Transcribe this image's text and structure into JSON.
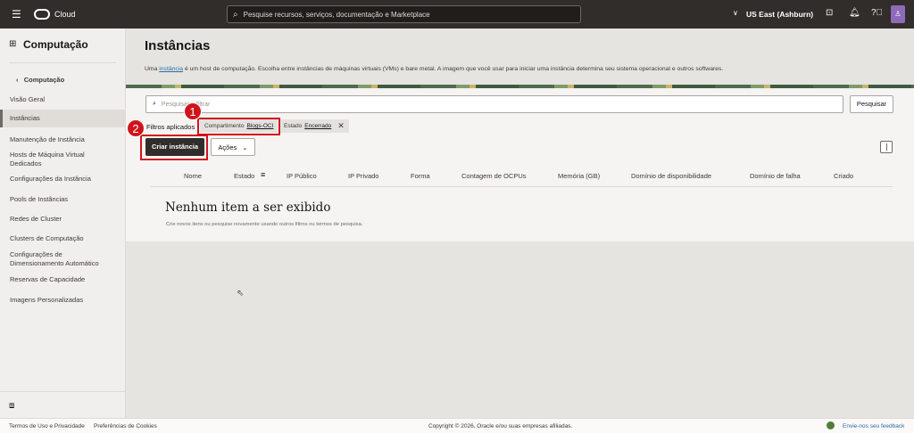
{
  "header": {
    "brand": "Cloud",
    "search_placeholder": "Pesquise recursos, serviços, documentação e Marketplace",
    "region": "US East (Ashburn)"
  },
  "sidebar": {
    "title": "Computação",
    "back": "Computação",
    "items": [
      "Visão Geral",
      "Instâncias",
      "Manutenção de Instância",
      "Hosts de Máquina Virtual Dedicados",
      "Configurações da Instância",
      "Pools de Instâncias",
      "Redes de Cluster",
      "Clusters de Computação",
      "Configurações de Dimensionamento Automático",
      "Reservas de Capacidade",
      "Imagens Personalizadas"
    ]
  },
  "page": {
    "title": "Instâncias",
    "desc_pre": "Uma ",
    "desc_link": "instância",
    "desc_post": " é um host de computação. Escolha entre instâncias de máquinas virtuais (VMs) e bare metal. A imagem que você usar para iniciar uma instância determina seu sistema operacional e outros softwares.",
    "filter_placeholder": "Pesquisar e filtrar",
    "search_button": "Pesquisar",
    "filters_label": "Filtros aplicados",
    "chips": [
      {
        "key": "Compartimento",
        "value": "Blogs-OCI"
      },
      {
        "key": "Estado",
        "value": "Encerrado"
      }
    ],
    "create_button": "Criar instância",
    "actions_button": "Ações",
    "columns": [
      "Nome",
      "Estado",
      "IP Público",
      "IP Privado",
      "Forma",
      "Contagem de OCPUs",
      "Memória (GB)",
      "Domínio de disponibilidade",
      "Domínio de falha",
      "Criado"
    ],
    "empty_title": "Nenhum item a ser exibido",
    "empty_sub": "Crie novos itens ou pesquise novamente usando outros filtros ou termos de pesquisa."
  },
  "annotations": [
    "1",
    "2"
  ],
  "footer": {
    "terms": "Termos de Uso e Privacidade",
    "cookies": "Preferências de Cookies",
    "copyright": "Copyright © 2026, Oracle e/ou suas empresas afiliadas.",
    "feedback": "Envie-nos seu feedback"
  }
}
